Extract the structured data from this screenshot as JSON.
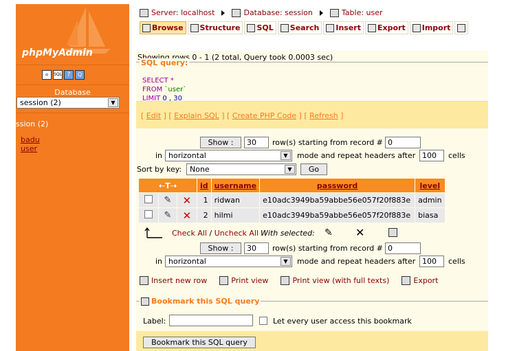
{
  "sidebar": {
    "logo_text": "phpMyAdmin",
    "icons": [
      "home-icon",
      "sql-icon",
      "help-icon",
      "query-window-icon"
    ],
    "database_label": "Database",
    "database_select": "session (2)",
    "db_heading": "ssion (2)",
    "tables": [
      "badu",
      "user"
    ]
  },
  "breadcrumb": {
    "server": "Server: localhost",
    "database": "Database: session",
    "table": "Table: user"
  },
  "tabs": [
    {
      "label": "Browse",
      "icon": "browse-icon"
    },
    {
      "label": "Structure",
      "icon": "structure-icon"
    },
    {
      "label": "SQL",
      "icon": "sql-icon"
    },
    {
      "label": "Search",
      "icon": "search-icon"
    },
    {
      "label": "Insert",
      "icon": "insert-icon"
    },
    {
      "label": "Export",
      "icon": "export-icon"
    },
    {
      "label": "Import",
      "icon": "import-icon"
    },
    {
      "label": "",
      "icon": "operations-icon"
    }
  ],
  "rows_info": "Showing rows 0 - 1 (2 total, Query took 0.0003 sec)",
  "sql_query": {
    "legend": "SQL query:",
    "select": "SELECT *",
    "from_kw": "FROM",
    "from_tbl": "`user`",
    "limit_kw": "LIMIT",
    "limit_val": "0 , 30"
  },
  "sql_links": {
    "edit": "Edit",
    "explain": "Explain SQL",
    "php": "Create PHP Code",
    "refresh": "Refresh"
  },
  "nav": {
    "show_label": "Show :",
    "rows_value": "30",
    "rows_text": "row(s) starting from record #",
    "record_value": "0",
    "in_text": "in",
    "mode_value": "horizontal",
    "mode_text": "mode and repeat headers after",
    "headers_value": "100",
    "cells_text": "cells"
  },
  "sort": {
    "label": "Sort by key:",
    "value": "None",
    "go": "Go"
  },
  "table": {
    "columns": [
      "id",
      "username",
      "password",
      "level"
    ],
    "rows": [
      {
        "id": "1",
        "username": "ridwan",
        "password": "e10adc3949ba59abbe56e057f20f883e",
        "level": "admin"
      },
      {
        "id": "2",
        "username": "hilmi",
        "password": "e10adc3949ba59abbe56e057f20f883e",
        "level": "biasa"
      }
    ]
  },
  "check_links": {
    "check_all": "Check All",
    "sep": " / ",
    "uncheck_all": "Uncheck All",
    "with_selected": "With selected:"
  },
  "actions": {
    "insert": "Insert new row",
    "print": "Print view",
    "print_full": "Print view (with full texts)",
    "export": "Export"
  },
  "bookmark": {
    "legend": "Bookmark this SQL query",
    "label": "Label:",
    "every_user": "Let every user access this bookmark",
    "button": "Bookmark this SQL query"
  }
}
